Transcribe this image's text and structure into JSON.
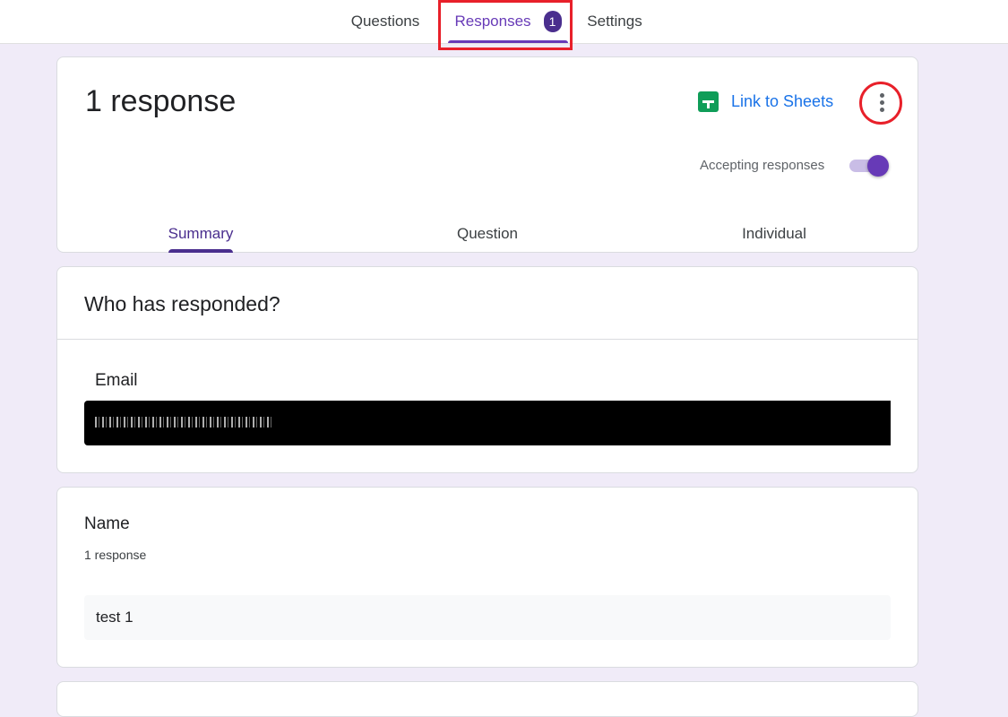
{
  "top_tabs": [
    {
      "label": "Questions"
    },
    {
      "label": "Responses",
      "badge": "1"
    },
    {
      "label": "Settings"
    }
  ],
  "summary_card": {
    "response_count": "1 response",
    "link_to_sheets": "Link to Sheets",
    "accepting_label": "Accepting responses",
    "accepting_on": true,
    "sub_tabs": [
      {
        "label": "Summary"
      },
      {
        "label": "Question"
      },
      {
        "label": "Individual"
      }
    ]
  },
  "respondents_card": {
    "title": "Who has responded?",
    "email_label": "Email"
  },
  "question_card": {
    "title": "Name",
    "count": "1 response",
    "answers": [
      "test 1"
    ]
  },
  "colors": {
    "accent": "#673ab7",
    "background": "#f0ebf8",
    "link": "#1a73e8",
    "sheets_green": "#0f9d58",
    "annotation_red": "#e8202a"
  },
  "icons": {
    "sheets": "google-sheets-icon",
    "more": "more-vert-icon"
  }
}
